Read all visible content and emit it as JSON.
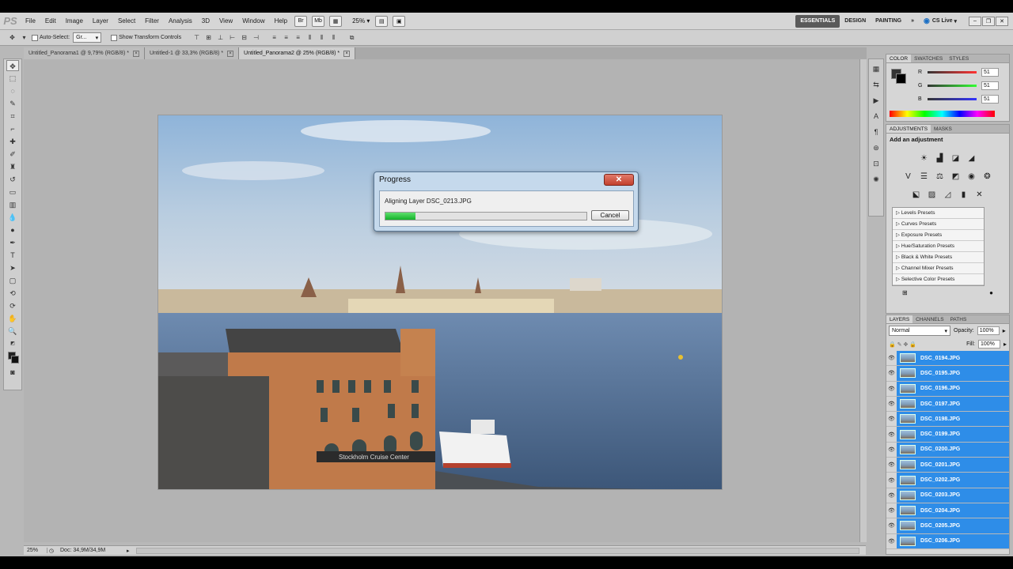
{
  "app": {
    "logo": "PS"
  },
  "menu": [
    "File",
    "Edit",
    "Image",
    "Layer",
    "Select",
    "Filter",
    "Analysis",
    "3D",
    "View",
    "Window",
    "Help"
  ],
  "menubar_zoom": "25%",
  "workspaces": {
    "essentials": "ESSENTIALS",
    "design": "DESIGN",
    "painting": "PAINTING",
    "more": "»",
    "cs_live": "CS Live"
  },
  "options": {
    "auto_select_label": "Auto-Select:",
    "auto_select_value": "Gr...",
    "transform_label": "Show Transform Controls"
  },
  "tabs": [
    {
      "label": "Untitled_Panorama1 @ 9,79% (RGB/8) *"
    },
    {
      "label": "Untitled-1 @ 33,3% (RGB/8) *"
    },
    {
      "label": "Untitled_Panorama2 @ 25% (RGB/8) *"
    }
  ],
  "status": {
    "zoom": "25%",
    "doc": "Doc: 34,9M/34,9M"
  },
  "progress_dialog": {
    "title": "Progress",
    "close": "✕",
    "message": "Aligning Layer DSC_0213.JPG",
    "progress": 0.15,
    "cancel": "Cancel"
  },
  "color_panel": {
    "tabs": [
      "COLOR",
      "SWATCHES",
      "STYLES"
    ],
    "channels": [
      {
        "label": "R",
        "value": "51"
      },
      {
        "label": "G",
        "value": "51"
      },
      {
        "label": "B",
        "value": "51"
      }
    ]
  },
  "adjustments_panel": {
    "tabs": [
      "ADJUSTMENTS",
      "MASKS"
    ],
    "heading": "Add an adjustment",
    "presets": [
      "Levels Presets",
      "Curves Presets",
      "Exposure Presets",
      "Hue/Saturation Presets",
      "Black & White Presets",
      "Channel Mixer Presets",
      "Selective Color Presets"
    ]
  },
  "layers_panel": {
    "tabs": [
      "LAYERS",
      "CHANNELS",
      "PATHS"
    ],
    "blend_mode": "Normal",
    "opacity_label": "Opacity:",
    "opacity": "100%",
    "fill_label": "Fill:",
    "fill": "100%",
    "layers": [
      "DSC_0194.JPG",
      "DSC_0195.JPG",
      "DSC_0196.JPG",
      "DSC_0197.JPG",
      "DSC_0198.JPG",
      "DSC_0199.JPG",
      "DSC_0200.JPG",
      "DSC_0201.JPG",
      "DSC_0202.JPG",
      "DSC_0203.JPG",
      "DSC_0204.JPG",
      "DSC_0205.JPG",
      "DSC_0206.JPG"
    ]
  },
  "photo_sign": "Stockholm Cruise Center",
  "colors": {
    "selection": "#2e8de8",
    "progress": "#14b32a",
    "dialog_close": "#c2412e"
  }
}
